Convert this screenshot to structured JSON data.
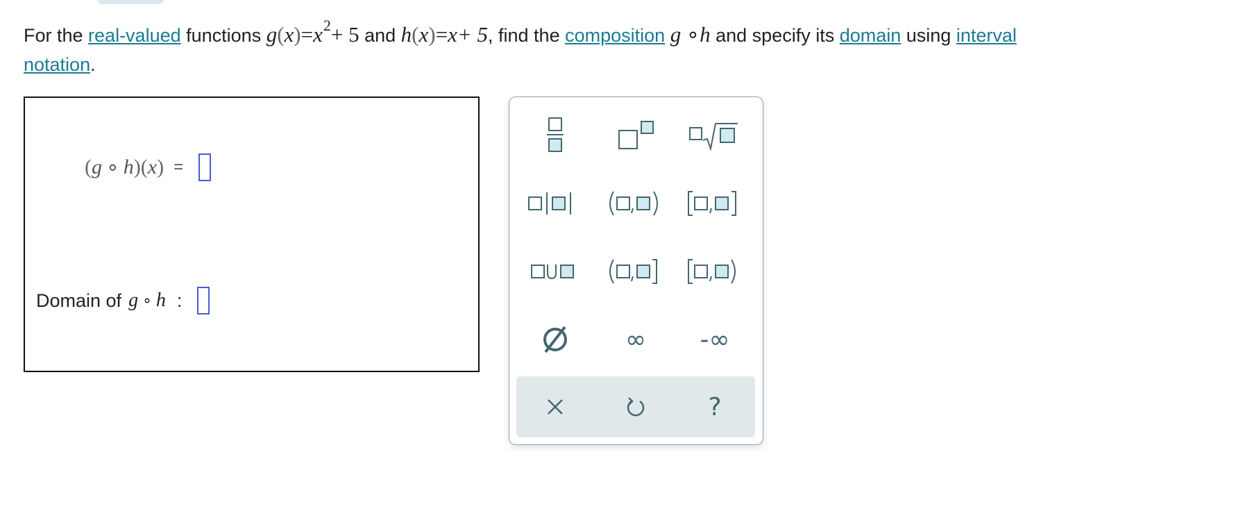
{
  "problem": {
    "text_1": "For the ",
    "link_real_valued": "real-valued",
    "text_2": " functions ",
    "g": "g",
    "x": "x",
    "eq": "=",
    "two": "2",
    "plus5": "+ 5",
    "text_and": " and ",
    "h": "h",
    "x_plus_5": "x+ 5",
    "text_find": ", find the ",
    "link_composition": "composition",
    "circ": "∘",
    "text_specify": " and specify its ",
    "link_domain": "domain",
    "text_using": " using ",
    "link_interval": "interval",
    "link_notation": "notation",
    "period": "."
  },
  "answer": {
    "composition_label": "(g ∘ h)(x)",
    "equals": "=",
    "domain_label": "Domain of",
    "colon": ":",
    "g": "g",
    "h": "h",
    "circ": "∘",
    "lparen": "(",
    "rparen": ")",
    "x": "x"
  },
  "keypad": {
    "buttons": [
      {
        "name": "fraction-button",
        "icon": "fraction-icon"
      },
      {
        "name": "superscript-button",
        "icon": "superscript-icon"
      },
      {
        "name": "nth-root-button",
        "icon": "nth-root-icon"
      },
      {
        "name": "absolute-value-button",
        "icon": "absolute-value-icon"
      },
      {
        "name": "open-interval-button",
        "icon": "open-interval-icon"
      },
      {
        "name": "closed-interval-button",
        "icon": "closed-interval-icon"
      },
      {
        "name": "union-button",
        "icon": "union-icon"
      },
      {
        "name": "left-open-interval-button",
        "icon": "left-open-interval-icon"
      },
      {
        "name": "right-open-interval-button",
        "icon": "right-open-interval-icon"
      },
      {
        "name": "empty-set-button",
        "icon": "empty-set-icon"
      },
      {
        "name": "infinity-button",
        "icon": "infinity-icon"
      },
      {
        "name": "negative-infinity-button",
        "icon": "negative-infinity-icon"
      }
    ],
    "infinity": "∞",
    "neg_infinity": "-∞",
    "empty_set": "Ø",
    "union": "∪",
    "help": "?",
    "colors": {
      "accent_fill": "#cfeaf0",
      "glyph": "#44666f",
      "border": "#8fa5ad",
      "bar": "#e1e8ea"
    }
  }
}
